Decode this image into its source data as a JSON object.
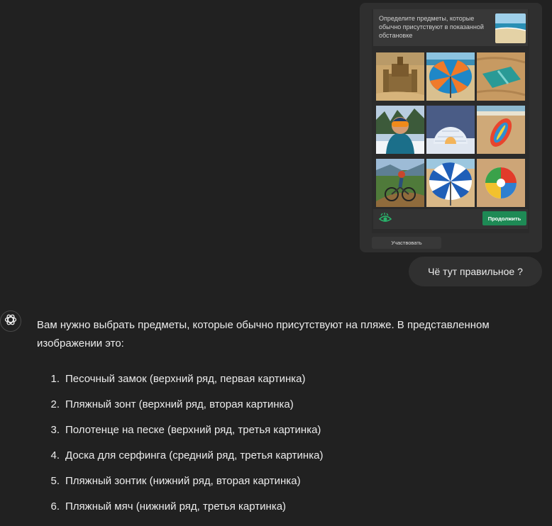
{
  "captcha": {
    "prompt": "Определите предметы, которые обычно присутствуют в показанной обстановке",
    "reference_image": "beach-scene",
    "tiles": [
      {
        "subject": "sandcastle"
      },
      {
        "subject": "beach-umbrella-orange-blue"
      },
      {
        "subject": "towel-on-sand"
      },
      {
        "subject": "skier-with-goggles"
      },
      {
        "subject": "igloo"
      },
      {
        "subject": "surfboard-on-sand"
      },
      {
        "subject": "mountain-biker"
      },
      {
        "subject": "beach-umbrella-blue-white"
      },
      {
        "subject": "beach-ball"
      }
    ],
    "continue_label": "Продолжить",
    "participate_label": "Участвовать",
    "accent_color": "#1e8a55"
  },
  "user_message": {
    "text": "Чё тут правильное ?"
  },
  "assistant": {
    "intro": "Вам нужно выбрать предметы, которые обычно присутствуют на пляже. В представленном изображении это:",
    "items": [
      {
        "num": "1.",
        "text": "Песочный замок (верхний ряд, первая картинка)"
      },
      {
        "num": "2.",
        "text": "Пляжный зонт (верхний ряд, вторая картинка)"
      },
      {
        "num": "3.",
        "text": "Полотенце на песке (верхний ряд, третья картинка)"
      },
      {
        "num": "4.",
        "text": "Доска для серфинга (средний ряд, третья картинка)"
      },
      {
        "num": "5.",
        "text": "Пляжный зонтик (нижний ряд, вторая картинка)"
      },
      {
        "num": "6.",
        "text": "Пляжный мяч (нижний ряд, третья картинка)"
      }
    ]
  }
}
